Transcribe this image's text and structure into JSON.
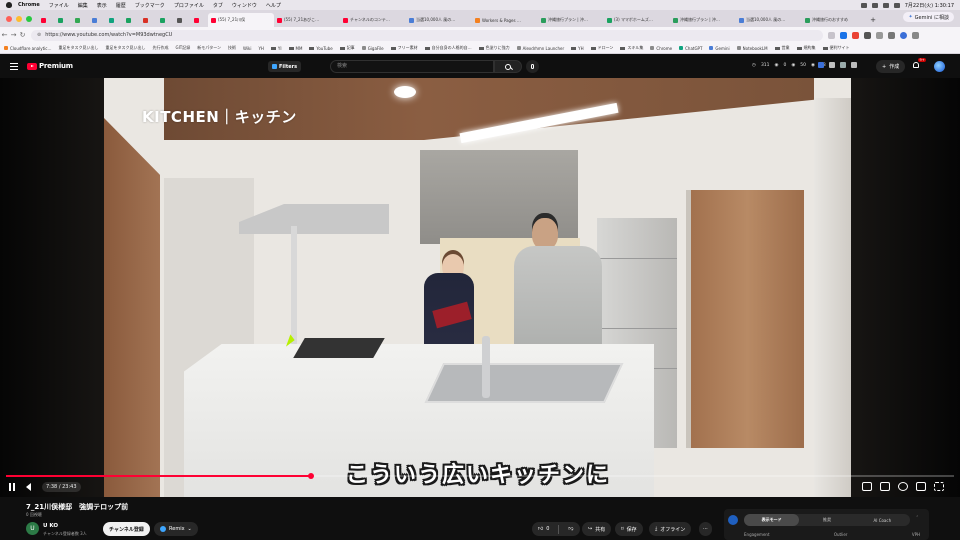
{
  "menubar": {
    "app": "Chrome",
    "items": [
      "ファイル",
      "編集",
      "表示",
      "履歴",
      "ブックマーク",
      "プロファイル",
      "タブ",
      "ウィンドウ",
      "ヘルプ"
    ],
    "clock": "7月22日(火) 1:30:17"
  },
  "tabs": [
    {
      "label": "(55) 7_21川俣",
      "color": "#ff0033",
      "active": true
    },
    {
      "label": "(55) 7_21あびこ…",
      "color": "#ff0033",
      "active": false
    },
    {
      "label": "チャンネルのコンテ…",
      "color": "#ff0033",
      "active": false
    },
    {
      "label": "当選10,000人 風の…",
      "color": "#4a7dd6",
      "active": false
    },
    {
      "label": "Workers & Pages …",
      "color": "#f38020",
      "active": false
    },
    {
      "label": "沖縄旅行プラン | 沖…",
      "color": "#2a9d5c",
      "active": false
    },
    {
      "label": "(3) ママボホームズ…",
      "color": "#1aa260",
      "active": false
    },
    {
      "label": "沖縄旅行プラン | 沖…",
      "color": "#2a9d5c",
      "active": false
    },
    {
      "label": "当選10,000人 風の…",
      "color": "#4a7dd6",
      "active": false
    },
    {
      "label": "沖縄旅行のおすすめ",
      "color": "#2a9d5c",
      "active": false
    }
  ],
  "gemini_button": "Gemini に相談",
  "address": {
    "url": "https://www.youtube.com/watch?v=M93dwtnegCU"
  },
  "bookmarks": [
    "Cloudflare analytic…",
    "重⾜をタスク⾒い出し",
    "重⾜をタスク⾒い出し",
    "先⾏作成",
    "GIT記録",
    "新モパターン",
    "技術",
    "Wiki",
    "YH",
    "YI",
    "MM",
    "YouTube",
    "記事",
    "GigaFile",
    "フリー素材",
    "⾃分⾃⾝の⼈格的⾃…",
    "色塗りに強⼒",
    "Alexdrhmn Launcher",
    "YH",
    "ドローン",
    "スキル集",
    "Chrome",
    "ChatGPT",
    "Gemini",
    "NotebookLM",
    "営業",
    "規約集",
    "便利サイト"
  ],
  "yt": {
    "logo": "Premium",
    "filters": "Filters",
    "search_placeholder": "検索",
    "ext_stats": [
      "311",
      "0",
      "50",
      "48"
    ],
    "create": "作成",
    "notif_count": "9+"
  },
  "video": {
    "overlay_title": "KITCHEN｜キッチン",
    "subtitle": "こういう広いキッチンに",
    "current_time": "7:38",
    "duration": "23:43",
    "progress": 0.322
  },
  "details": {
    "title": "7_21川俣様邸　強調テロップ前",
    "views": "0 回視聴",
    "channel": "U KO",
    "channel_initial": "U",
    "subs": "チャンネル登録者数 3人",
    "subscribe": "チャンネル登録",
    "remix": "Remix",
    "likes": "0",
    "share": "共有",
    "save": "保存",
    "offline": "オフライン",
    "more": "···"
  },
  "ext_panel": {
    "modes": [
      "表示モード",
      "推奨",
      "AI Coach"
    ],
    "selected": 0,
    "metrics": [
      "Engagement",
      "Outlier",
      "VPH"
    ],
    "collapse": "ˆ"
  },
  "colors": {
    "brand": "#ff0033",
    "bg": "#0f0f0f",
    "accent": "#3ea6ff"
  }
}
